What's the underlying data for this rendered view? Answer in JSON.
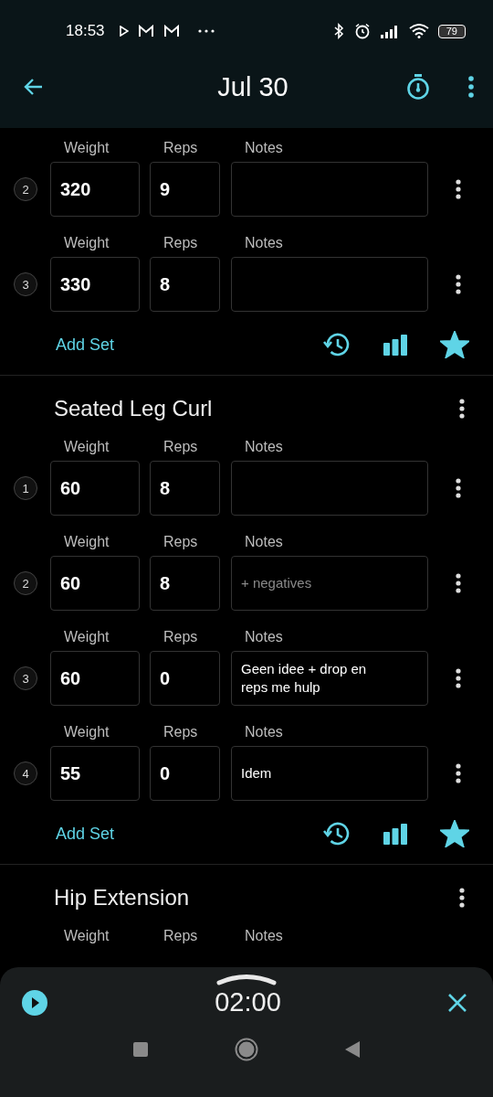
{
  "status_bar": {
    "time": "18:53",
    "battery": "79"
  },
  "app_bar": {
    "title": "Jul 30"
  },
  "exercises": [
    {
      "sets": [
        {
          "number": "2",
          "labels": [
            "Weight",
            "Reps",
            "Notes"
          ],
          "weight": "320",
          "reps": "9"
        },
        {
          "number": "3",
          "labels": [
            "Weight",
            "Reps",
            "Notes"
          ],
          "weight": "330",
          "reps": "8"
        }
      ],
      "add_set": "Add Set",
      "starred": true
    },
    {
      "name": "Seated Leg Curl",
      "sets": [
        {
          "number": "1",
          "labels": [
            "Weight",
            "Reps",
            "Notes"
          ],
          "weight": "60",
          "reps": "8"
        },
        {
          "number": "2",
          "labels": [
            "Weight",
            "Reps",
            "Notes"
          ],
          "weight": "60",
          "reps": "8",
          "notes_placeholder": "+ negatives"
        },
        {
          "number": "3",
          "labels": [
            "Weight",
            "Reps",
            "Notes"
          ],
          "weight": "60",
          "reps": "0",
          "notes": "Geen idee + drop en reps me hulp"
        },
        {
          "number": "4",
          "labels": [
            "Weight",
            "Reps",
            "Notes"
          ],
          "weight": "55",
          "reps": "0",
          "notes": "Idem"
        }
      ],
      "add_set": "Add Set",
      "starred": true
    },
    {
      "name": "Hip Extension",
      "sets": [
        {
          "labels": [
            "Weight",
            "Reps",
            "Notes"
          ]
        }
      ]
    }
  ],
  "timer": {
    "time": "02:00"
  }
}
